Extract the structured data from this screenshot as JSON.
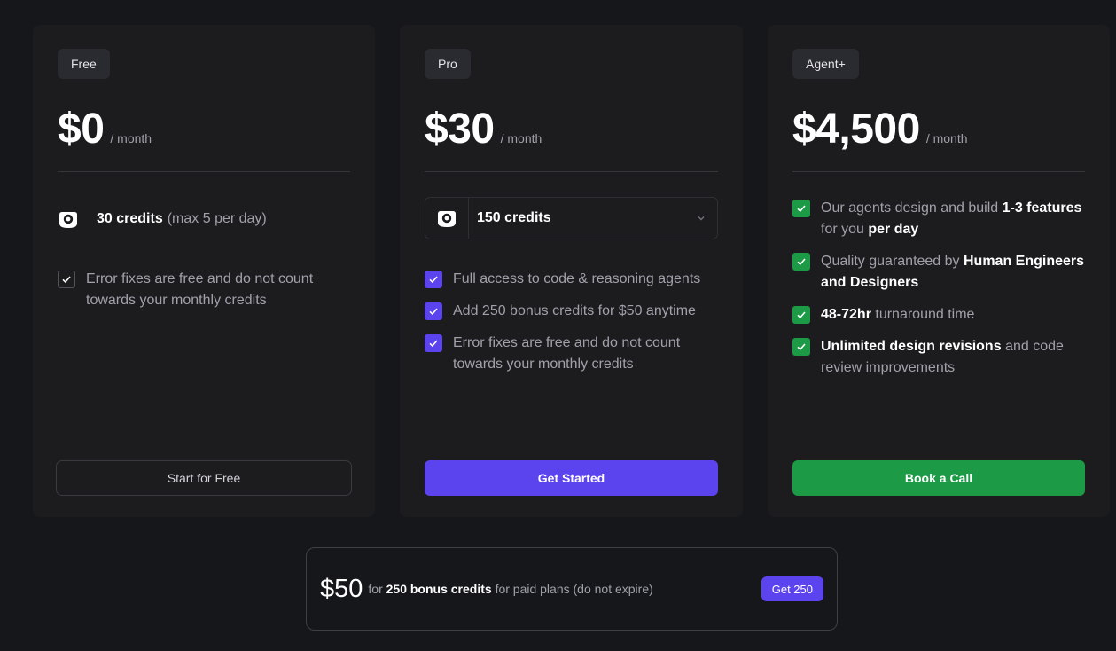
{
  "plans": [
    {
      "badge": "Free",
      "price": "$0",
      "period": "/ month",
      "credits_bold": "30 credits",
      "credits_muted": "(max 5 per day)",
      "features": [
        "Error fixes are free and do not count towards your monthly credits"
      ],
      "cta": "Start for Free"
    },
    {
      "badge": "Pro",
      "price": "$30",
      "period": "/ month",
      "credits_select": "150 credits",
      "features": [
        "Full access to code & reasoning agents",
        "Add 250 bonus credits for $50 anytime",
        "Error fixes are free and do not count towards your monthly credits"
      ],
      "cta": "Get Started"
    },
    {
      "badge": "Agent+",
      "price": "$4,500",
      "period": "/ month",
      "features": [
        {
          "a": "Our agents design and build ",
          "b": "1-3 features",
          "c": " for you ",
          "d": "per day"
        },
        {
          "a": "Quality guaranteed by ",
          "b": "Human Engineers and Designers"
        },
        {
          "b": "48-72hr",
          "c": " turnaround time"
        },
        {
          "b": "Unlimited design revisions",
          "c": " and code review improvements"
        }
      ],
      "cta": "Book a Call"
    }
  ],
  "bonus": {
    "amount": "$50",
    "for": "for",
    "credits": "250 bonus credits",
    "suffix": "for paid plans (do not expire)",
    "button": "Get 250"
  },
  "colors": {
    "accent_purple": "#5b43ee",
    "accent_green": "#1c9a45",
    "background": "#16171b",
    "card": "#1c1c1f"
  },
  "icons": {
    "credit": "camera-lens-icon",
    "check": "check-icon",
    "chevron": "chevron-down-icon"
  }
}
